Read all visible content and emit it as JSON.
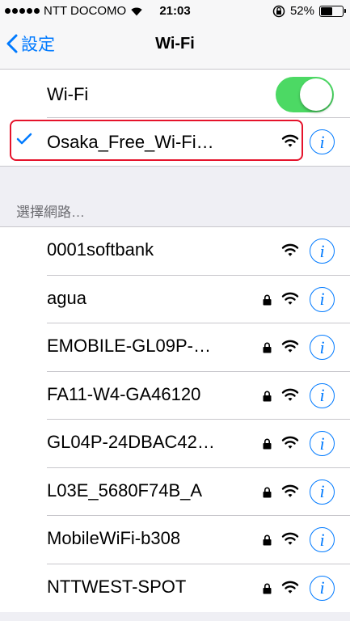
{
  "status_bar": {
    "carrier": "NTT DOCOMO",
    "time": "21:03",
    "battery_text": "52%",
    "battery_level": 0.52
  },
  "nav": {
    "back_label": "設定",
    "title": "Wi-Fi"
  },
  "wifi_toggle": {
    "label": "Wi-Fi",
    "on": true
  },
  "connected": {
    "name": "Osaka_Free_Wi-Fi…",
    "secured": false
  },
  "section_header": "選擇網路…",
  "networks": [
    {
      "name": "0001softbank",
      "secured": false
    },
    {
      "name": "agua",
      "secured": true
    },
    {
      "name": "EMOBILE-GL09P-…",
      "secured": true
    },
    {
      "name": "FA11-W4-GA46120",
      "secured": true
    },
    {
      "name": "GL04P-24DBAC42…",
      "secured": true
    },
    {
      "name": "L03E_5680F74B_A",
      "secured": true
    },
    {
      "name": "MobileWiFi-b308",
      "secured": true
    },
    {
      "name": "NTTWEST-SPOT",
      "secured": true
    }
  ],
  "colors": {
    "accent": "#007aff",
    "toggle_on": "#4cd964",
    "highlight": "#e5132b"
  }
}
